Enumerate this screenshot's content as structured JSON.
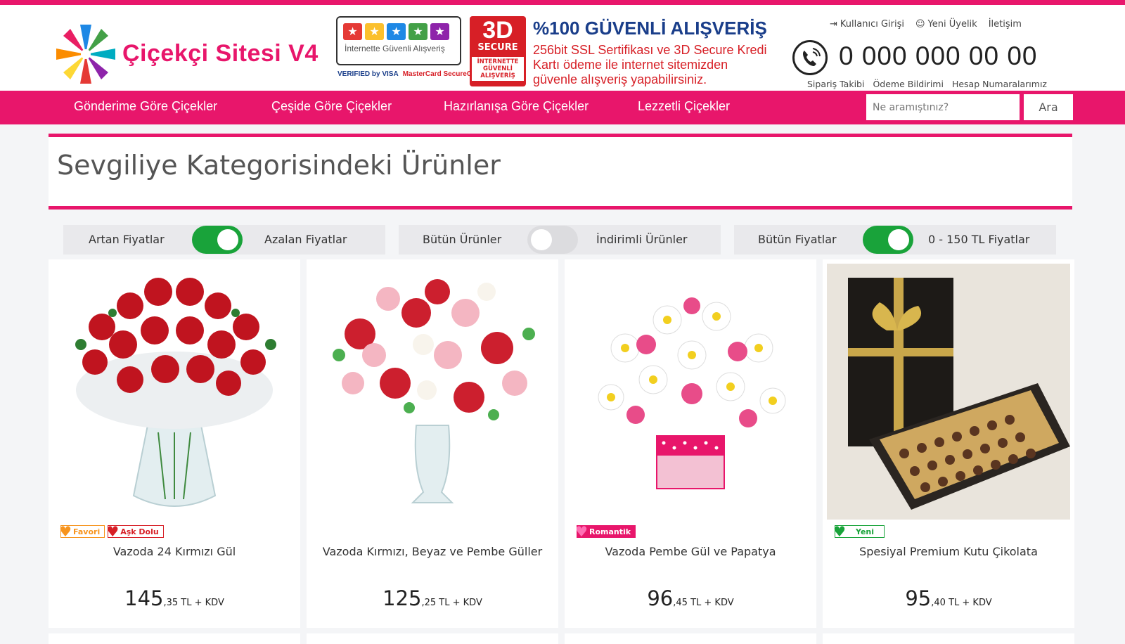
{
  "header": {
    "site_name": "Çiçekçi Sitesi V4",
    "badge_text": "İnternette Güvenli Alışveriş",
    "cards_text": [
      "VERIFIED by VISA",
      "MasterCard SecureCode"
    ],
    "secure3d": {
      "big": "3D",
      "label": "SECURE",
      "small": "İNTERNETTE GÜVENLİ ALIŞVERİŞ"
    },
    "safe_title": "%100 GÜVENLİ ALIŞVERİŞ",
    "safe_text": "256bit SSL Sertifikası ve 3D Secure Kredi Kartı ödeme ile internet sitemizden güvenle alışveriş yapabilirsiniz.",
    "top_links": {
      "login": "Kullanıcı Girişi",
      "register": "Yeni Üyelik",
      "contact": "İletişim"
    },
    "phone": "0 000 000 00 00",
    "sub_links": [
      "Sipariş Takibi",
      "Ödeme Bildirimi",
      "Hesap Numaralarımız"
    ]
  },
  "nav": {
    "items": [
      "Gönderime Göre Çiçekler",
      "Çeşide Göre Çiçekler",
      "Hazırlanışa Göre Çiçekler",
      "Lezzetli Çiçekler"
    ],
    "search_placeholder": "Ne aramıştınız?",
    "search_button": "Ara"
  },
  "page_title": "Sevgiliye Kategorisindeki Ürünler",
  "filters": [
    {
      "left": "Artan Fiyatlar",
      "right": "Azalan Fiyatlar",
      "on": true
    },
    {
      "left": "Bütün Ürünler",
      "right": "İndirimli Ürünler",
      "on": false
    },
    {
      "left": "Bütün Fiyatlar",
      "right": "0 - 150 TL Fiyatlar",
      "on": true
    }
  ],
  "products": [
    {
      "name": "Vazoda 24 Kırmızı Gül",
      "price_main": "145",
      "price_decimal": ",35 TL + KDV",
      "tags": [
        "Favori",
        "Aşk Dolu"
      ]
    },
    {
      "name": "Vazoda Kırmızı, Beyaz ve Pembe Güller",
      "price_main": "125",
      "price_decimal": ",25 TL + KDV",
      "tags": []
    },
    {
      "name": "Vazoda Pembe Gül ve Papatya",
      "price_main": "96",
      "price_decimal": ",45 TL + KDV",
      "tags": [
        "Romantik"
      ]
    },
    {
      "name": "Spesiyal Premium Kutu Çikolata",
      "price_main": "95",
      "price_decimal": ",40 TL + KDV",
      "tags": [
        "Yeni"
      ]
    }
  ],
  "colors": {
    "brand": "#e8166b",
    "toggle_on": "#19a33a",
    "secure_red": "#d71f26",
    "safe_blue": "#1a3e8a"
  }
}
